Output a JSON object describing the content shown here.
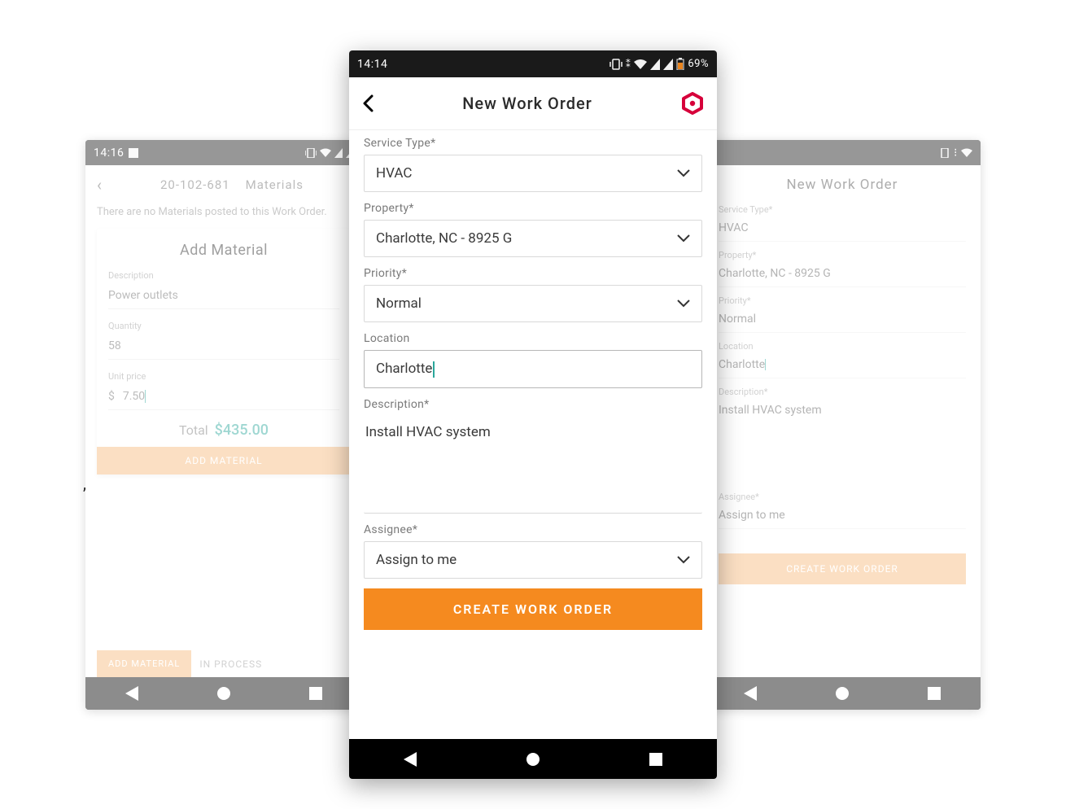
{
  "statusbar_main": {
    "time": "14:14",
    "battery": "69%"
  },
  "statusbar_left": {
    "time": "14:16"
  },
  "main": {
    "title": "New Work Order",
    "service_type_label": "Service Type*",
    "service_type": "HVAC",
    "property_label": "Property*",
    "property": "Charlotte, NC - 8925 G",
    "priority_label": "Priority*",
    "priority": "Normal",
    "location_label": "Location",
    "location": "Charlotte",
    "description_label": "Description*",
    "description": "Install HVAC system",
    "assignee_label": "Assignee*",
    "assignee": "Assign to me",
    "create_button": "CREATE WORK ORDER"
  },
  "left_bg": {
    "header_id": "20-102-681",
    "header_tab": "Materials",
    "msg": "There are no Materials posted to this Work Order.",
    "card_title": "Add Material",
    "desc_label": "Description",
    "desc": "Power outlets",
    "qty_label": "Quantity",
    "qty": "58",
    "unit_label": "Unit price",
    "currency": "$",
    "unit": "7.50",
    "total_label": "Total",
    "total": "$435.00",
    "add_btn": "ADD MATERIAL",
    "chip": "ADD MATERIAL",
    "inproc": "IN PROCESS"
  },
  "right_bg": {
    "title": "New Work Order",
    "service_type_label": "Service Type*",
    "service_type": "HVAC",
    "property_label": "Property*",
    "property": "Charlotte, NC - 8925 G",
    "priority_label": "Priority*",
    "priority": "Normal",
    "location_label": "Location",
    "location": "Charlotte",
    "description_label": "Description*",
    "description": "Install HVAC system",
    "assignee_label": "Assignee*",
    "assignee": "Assign to me",
    "create_button": "CREATE WORK ORDER"
  }
}
